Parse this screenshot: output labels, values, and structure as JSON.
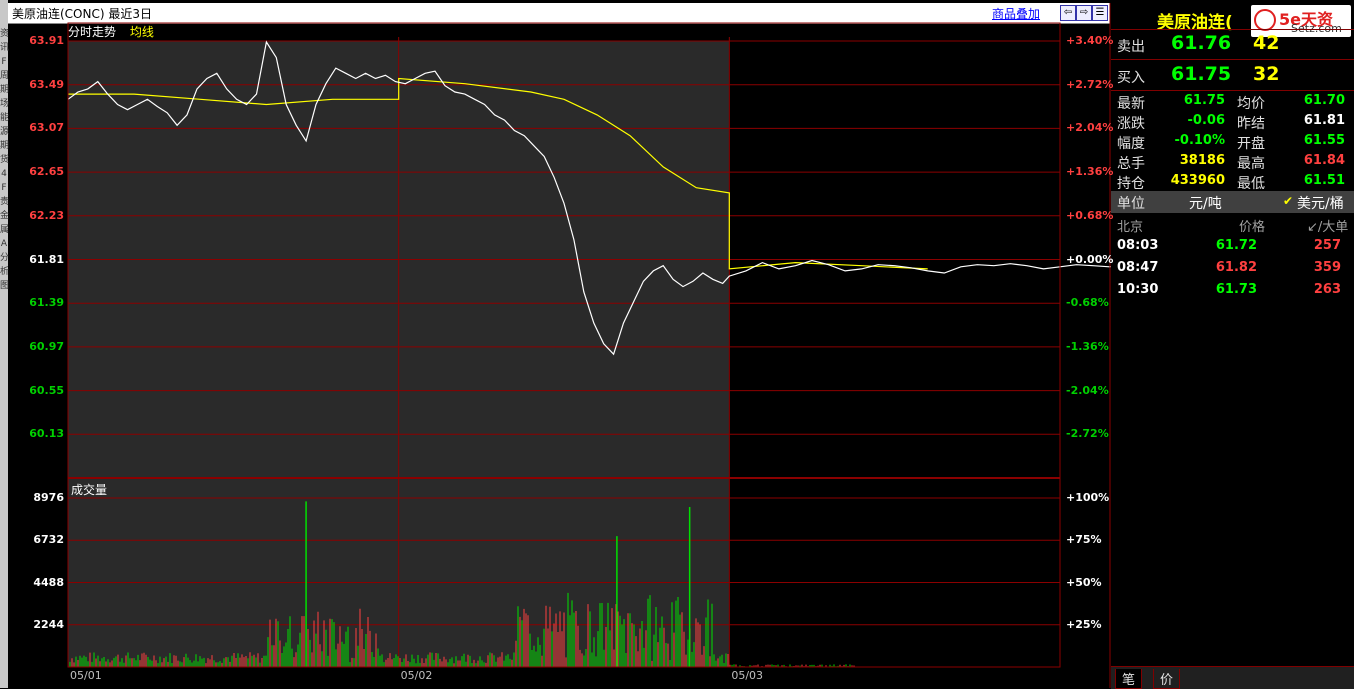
{
  "window": {
    "title": "美原油连(CONC) 最近3日",
    "overlay_link": "商品叠加",
    "nav_buttons": [
      "⇦",
      "⇨",
      "☰"
    ]
  },
  "chart_tabs": {
    "main": "分时走势",
    "avg": "均线"
  },
  "left_strip": [
    "资",
    "讯",
    "F",
    "周",
    "期",
    "场",
    "能",
    "源",
    "期",
    "货",
    "4",
    "F",
    "贵",
    "金",
    "属",
    "A",
    "分",
    "析",
    "图"
  ],
  "colors": {
    "up": "#ff4040",
    "down": "#00d000",
    "flat": "#ffffff",
    "grid": "#8b0000",
    "price_line": "#ffffff",
    "avg_line": "#ffff00"
  },
  "chart_data": [
    {
      "type": "line",
      "name": "price",
      "y_ticks": [
        "63.91",
        "63.49",
        "63.07",
        "62.65",
        "62.23",
        "61.81",
        "61.39",
        "60.97",
        "60.55",
        "60.13"
      ],
      "pct_ticks": [
        "+3.40%",
        "+2.72%",
        "+2.04%",
        "+1.36%",
        "+0.68%",
        "+0.00%",
        "-0.68%",
        "-1.36%",
        "-2.04%",
        "-2.72%"
      ],
      "ylim": [
        59.71,
        63.91
      ],
      "reference": 61.81,
      "x_labels": [
        "05/01",
        "05/02",
        "05/03"
      ],
      "series": [
        {
          "name": "分时走势",
          "x": [
            0,
            0.03,
            0.06,
            0.09,
            0.12,
            0.15,
            0.18,
            0.21,
            0.24,
            0.27,
            0.3,
            0.33,
            0.36,
            0.39,
            0.42,
            0.45,
            0.48,
            0.51,
            0.54,
            0.57,
            0.6,
            0.63,
            0.66,
            0.69,
            0.72,
            0.75,
            0.78,
            0.81,
            0.84,
            0.87,
            0.9,
            0.93,
            0.96,
            0.99,
            1.02,
            1.05,
            1.08,
            1.11,
            1.14,
            1.17,
            1.2,
            1.23,
            1.26,
            1.29,
            1.32,
            1.35,
            1.38,
            1.41,
            1.44,
            1.47,
            1.5,
            1.53,
            1.56,
            1.59,
            1.62,
            1.65,
            1.68,
            1.71,
            1.74,
            1.77,
            1.8,
            1.83,
            1.86,
            1.89,
            1.92,
            1.95,
            1.98,
            2.0,
            2.05,
            2.1,
            2.15,
            2.2,
            2.25,
            2.3,
            2.35,
            2.4,
            2.45,
            2.5,
            2.55,
            2.6,
            2.65,
            2.7,
            2.75,
            2.8,
            2.85,
            2.9,
            2.95,
            3.0,
            3.05,
            3.1,
            3.15,
            3.2,
            3.25,
            3.3,
            3.35,
            3.4,
            3.45,
            3.5,
            3.55,
            3.6
          ],
          "values": [
            63.35,
            63.42,
            63.45,
            63.52,
            63.4,
            63.3,
            63.25,
            63.3,
            63.35,
            63.28,
            63.22,
            63.1,
            63.2,
            63.45,
            63.55,
            63.6,
            63.45,
            63.35,
            63.3,
            63.4,
            63.9,
            63.75,
            63.3,
            63.1,
            62.95,
            63.3,
            63.5,
            63.65,
            63.6,
            63.55,
            63.6,
            63.55,
            63.58,
            63.52,
            63.5,
            63.55,
            63.6,
            63.62,
            63.48,
            63.42,
            63.4,
            63.35,
            63.3,
            63.2,
            63.15,
            63.05,
            63.0,
            62.9,
            62.8,
            62.6,
            62.35,
            62.0,
            61.5,
            61.2,
            61.0,
            60.9,
            61.2,
            61.4,
            61.6,
            61.7,
            61.75,
            61.62,
            61.55,
            61.6,
            61.68,
            61.62,
            61.58,
            61.65,
            61.7,
            61.78,
            61.72,
            61.75,
            61.8,
            61.76,
            61.7,
            61.72,
            61.76,
            61.75,
            61.73,
            61.7,
            61.68,
            61.74,
            61.76,
            61.75,
            61.77,
            61.75,
            61.72,
            61.74,
            61.76,
            61.75,
            61.74,
            61.76,
            61.75,
            61.73,
            61.74,
            61.75,
            61.76,
            61.75,
            61.75,
            61.75
          ]
        },
        {
          "name": "均线",
          "x": [
            0,
            0.2,
            0.4,
            0.6,
            0.8,
            1.0,
            1.0,
            1.2,
            1.4,
            1.5,
            1.6,
            1.7,
            1.8,
            1.9,
            2.0,
            2.0,
            2.2,
            2.4,
            2.6
          ],
          "values": [
            63.4,
            63.4,
            63.35,
            63.3,
            63.35,
            63.35,
            63.55,
            63.5,
            63.42,
            63.35,
            63.2,
            63.0,
            62.7,
            62.5,
            62.45,
            61.72,
            61.78,
            61.75,
            61.72
          ]
        }
      ]
    },
    {
      "type": "bar",
      "name": "volume",
      "title": "成交量",
      "y_ticks": [
        "8976",
        "6732",
        "4488",
        "2244"
      ],
      "pct_ticks": [
        "+100%",
        "+75%",
        "+50%",
        "+25%"
      ],
      "ylim": [
        0,
        8976
      ],
      "peaks": [
        {
          "x": 0.72,
          "value": 8800
        },
        {
          "x": 1.66,
          "value": 6950
        },
        {
          "x": 1.88,
          "value": 8500
        }
      ]
    }
  ],
  "quote": {
    "name": "美原油连(",
    "logo_text": "5e天资",
    "logo_sub": "Setz.com",
    "sell_label": "卖出",
    "sell_price": "61.76",
    "sell_vol": "42",
    "buy_label": "买入",
    "buy_price": "61.75",
    "buy_vol": "32",
    "fields": [
      {
        "k1": "最新",
        "v1": "61.75",
        "c1": "#00ff00",
        "k2": "均价",
        "v2": "61.70",
        "c2": "#00ff00"
      },
      {
        "k1": "涨跌",
        "v1": "-0.06",
        "c1": "#00ff00",
        "k2": "昨结",
        "v2": "61.81",
        "c2": "#ffffff"
      },
      {
        "k1": "幅度",
        "v1": "-0.10%",
        "c1": "#00ff00",
        "k2": "开盘",
        "v2": "61.55",
        "c2": "#00ff00"
      },
      {
        "k1": "总手",
        "v1": "38186",
        "c1": "#ffff00",
        "k2": "最高",
        "v2": "61.84",
        "c2": "#ff4040"
      },
      {
        "k1": "持仓",
        "v1": "433960",
        "c1": "#ffff00",
        "k2": "最低",
        "v2": "61.51",
        "c2": "#00ff00"
      }
    ],
    "unit_label": "单位",
    "unit_value": "元/吨",
    "unit_alt": "美元/桶",
    "trade_headers": [
      "北京",
      "价格",
      "↙/大单"
    ],
    "trades": [
      {
        "time": "08:03",
        "price": "61.72",
        "price_color": "#00ff00",
        "vol": "257"
      },
      {
        "time": "08:47",
        "price": "61.82",
        "price_color": "#ff4040",
        "vol": "359"
      },
      {
        "time": "10:30",
        "price": "61.73",
        "price_color": "#00ff00",
        "vol": "263"
      }
    ],
    "bottom_tabs": [
      "笔",
      "价"
    ]
  }
}
